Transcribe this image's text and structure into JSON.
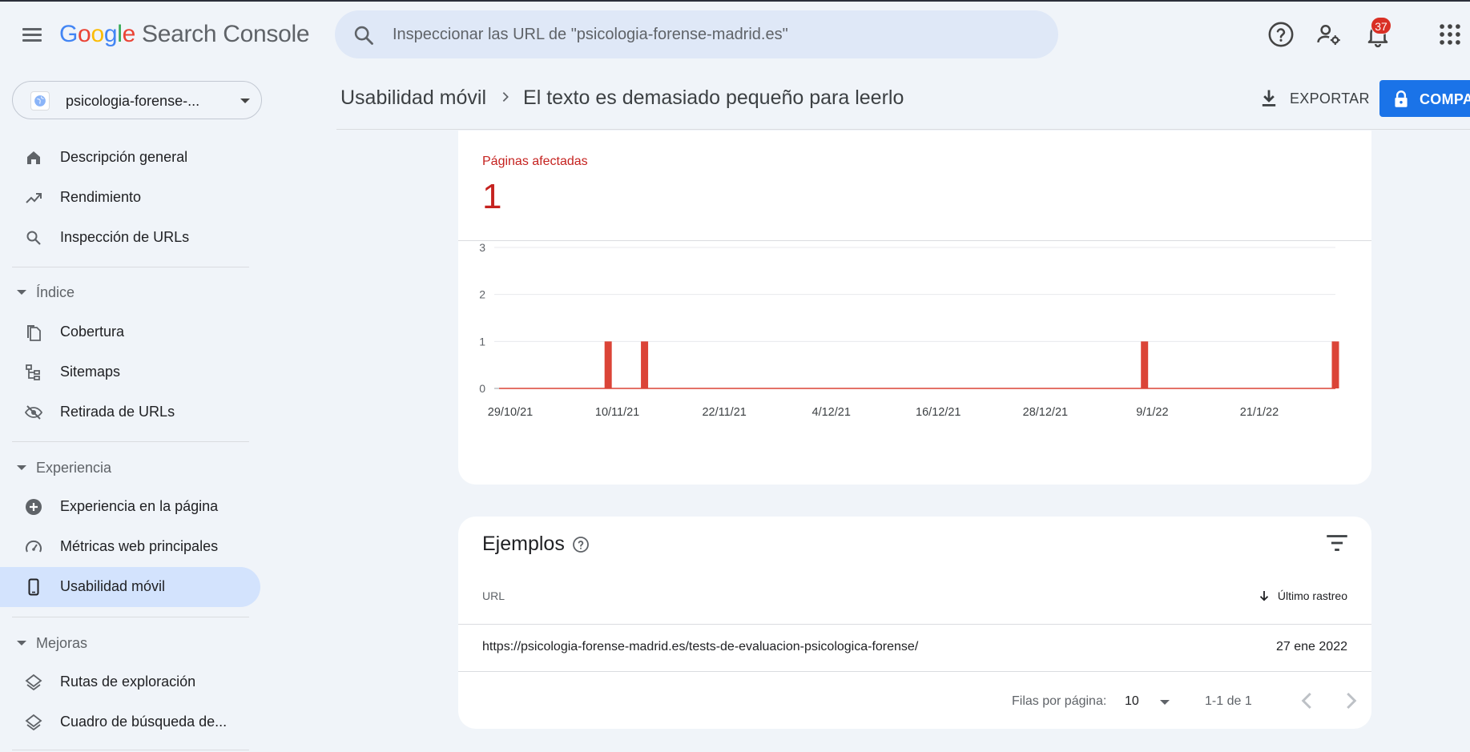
{
  "app": {
    "logo": [
      "G",
      "o",
      "o",
      "g",
      "l",
      "e"
    ],
    "name": "Search Console",
    "notifications_count": "37"
  },
  "search": {
    "placeholder": "Inspeccionar las URL de \"psicologia-forense-madrid.es\""
  },
  "property": {
    "name": "psicologia-forense-..."
  },
  "sidebar": {
    "items": [
      {
        "label": "Descripción general",
        "icon": "home-icon"
      },
      {
        "label": "Rendimiento",
        "icon": "trending-up-icon"
      },
      {
        "label": "Inspección de URLs",
        "icon": "search-icon"
      }
    ],
    "sections": [
      {
        "title": "Índice",
        "items": [
          {
            "label": "Cobertura",
            "icon": "file-copy-icon"
          },
          {
            "label": "Sitemaps",
            "icon": "sitemap-icon"
          },
          {
            "label": "Retirada de URLs",
            "icon": "eye-off-icon"
          }
        ]
      },
      {
        "title": "Experiencia",
        "items": [
          {
            "label": "Experiencia en la página",
            "icon": "plus-circle-icon"
          },
          {
            "label": "Métricas web principales",
            "icon": "speedometer-icon"
          },
          {
            "label": "Usabilidad móvil",
            "icon": "phone-icon",
            "active": true
          }
        ]
      },
      {
        "title": "Mejoras",
        "items": [
          {
            "label": "Rutas de exploración",
            "icon": "layers-icon"
          },
          {
            "label": "Cuadro de búsqueda de...",
            "icon": "layers-icon"
          }
        ]
      }
    ]
  },
  "breadcrumb": {
    "parent": "Usabilidad móvil",
    "current": "El texto es demasiado pequeño para leerlo"
  },
  "actions": {
    "export_label": "EXPORTAR",
    "share_label": "COMPA"
  },
  "summary": {
    "label": "Páginas afectadas",
    "value": "1"
  },
  "chart_data": {
    "type": "bar",
    "title": "",
    "xlabel": "",
    "ylabel": "",
    "ylim": [
      0,
      3
    ],
    "y_ticks": [
      "0",
      "1",
      "2",
      "3"
    ],
    "x_ticks": [
      "29/10/21",
      "10/11/21",
      "22/11/21",
      "4/12/21",
      "16/12/21",
      "28/12/21",
      "9/1/22",
      "21/1/22"
    ],
    "x_start": "2021-10-29",
    "x_end": "2022-01-29",
    "series": [
      {
        "color": "#db4437",
        "points": [
          {
            "date": "2021-11-10",
            "value": 1
          },
          {
            "date": "2021-11-14",
            "value": 1
          },
          {
            "date": "2022-01-08",
            "value": 1
          },
          {
            "date": "2022-01-29",
            "value": 1
          }
        ]
      }
    ],
    "grid": true
  },
  "examples": {
    "title": "Ejemplos",
    "col_url": "URL",
    "col_date": "Último rastreo",
    "rows": [
      {
        "url": "https://psicologia-forense-madrid.es/tests-de-evaluacion-psicologica-forense/",
        "date": "27 ene 2022"
      }
    ],
    "rows_per_page_label": "Filas por página:",
    "rows_per_page": "10",
    "range": "1-1 de 1"
  },
  "colors": {
    "accent": "#1a73e8",
    "error": "#c5221f",
    "active_nav": "#d3e3fd",
    "background": "#f0f4f9"
  }
}
